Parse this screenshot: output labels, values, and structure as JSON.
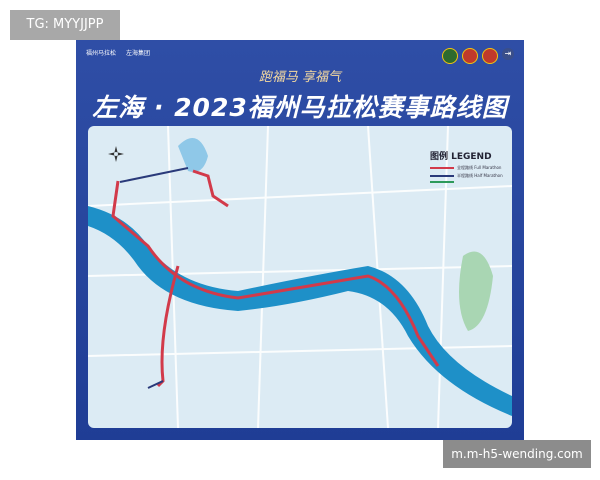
{
  "watermarks": {
    "top_left": "TG: MYYJJPP",
    "bottom_right": "m.m-h5-wending.com"
  },
  "poster": {
    "logos": [
      "福州马拉松",
      "左海集团"
    ],
    "slogan": "跑福马 享福气",
    "title": "左海 · 2023福州马拉松赛事路线图",
    "legend": {
      "title": "图例 LEGEND",
      "items": [
        {
          "label": "全程路线 Full Marathon",
          "color": "#d23a4a"
        },
        {
          "label": "半程路线 Half Marathon",
          "color": "#2a3a7a"
        },
        {
          "label": "",
          "color": "#2e9a5a"
        }
      ]
    }
  },
  "colors": {
    "river": "#1e90c8",
    "map_bg": "#dcebf4",
    "poster": "#2a479f",
    "route": "#d23a4a"
  }
}
